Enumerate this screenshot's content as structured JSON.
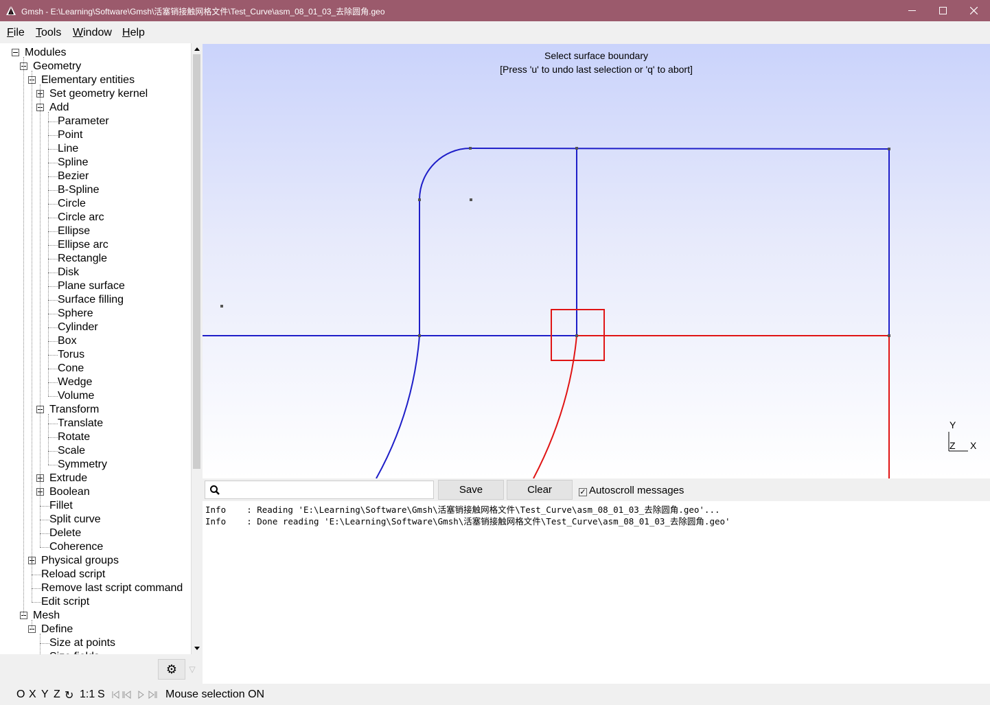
{
  "window": {
    "title": "Gmsh - E:\\Learning\\Software\\Gmsh\\活塞销接触网格文件\\Test_Curve\\asm_08_01_03_去除圆角.geo",
    "controls": [
      "minimize",
      "maximize",
      "close"
    ]
  },
  "menu": [
    {
      "key": "F",
      "rest": "ile"
    },
    {
      "key": "T",
      "rest": "ools"
    },
    {
      "key": "W",
      "rest": "indow"
    },
    {
      "key": "H",
      "rest": "elp"
    }
  ],
  "tree": {
    "items": [
      {
        "label": "Modules",
        "box": "minus"
      },
      {
        "label": "Geometry",
        "box": "minus"
      },
      {
        "label": "Elementary entities",
        "box": "minus"
      },
      {
        "label": "Set geometry kernel",
        "box": "plus"
      },
      {
        "label": "Add",
        "box": "minus"
      },
      {
        "label": "Parameter"
      },
      {
        "label": "Point"
      },
      {
        "label": "Line"
      },
      {
        "label": "Spline"
      },
      {
        "label": "Bezier"
      },
      {
        "label": "B-Spline"
      },
      {
        "label": "Circle"
      },
      {
        "label": "Circle arc"
      },
      {
        "label": "Ellipse"
      },
      {
        "label": "Ellipse arc"
      },
      {
        "label": "Rectangle"
      },
      {
        "label": "Disk"
      },
      {
        "label": "Plane surface"
      },
      {
        "label": "Surface filling"
      },
      {
        "label": "Sphere"
      },
      {
        "label": "Cylinder"
      },
      {
        "label": "Box"
      },
      {
        "label": "Torus"
      },
      {
        "label": "Cone"
      },
      {
        "label": "Wedge"
      },
      {
        "label": "Volume"
      },
      {
        "label": "Transform",
        "box": "minus"
      },
      {
        "label": "Translate"
      },
      {
        "label": "Rotate"
      },
      {
        "label": "Scale"
      },
      {
        "label": "Symmetry"
      },
      {
        "label": "Extrude",
        "box": "plus"
      },
      {
        "label": "Boolean",
        "box": "plus"
      },
      {
        "label": "Fillet"
      },
      {
        "label": "Split curve"
      },
      {
        "label": "Delete"
      },
      {
        "label": "Coherence"
      },
      {
        "label": "Physical groups",
        "box": "plus"
      },
      {
        "label": "Reload script"
      },
      {
        "label": "Remove last script command"
      },
      {
        "label": "Edit script"
      },
      {
        "label": "Mesh",
        "box": "minus"
      },
      {
        "label": "Define",
        "box": "minus"
      },
      {
        "label": "Size at points"
      },
      {
        "label": "Size fields"
      }
    ]
  },
  "graphics": {
    "prompt_line1": "Select surface boundary",
    "prompt_line2": "[Press 'u' to undo last selection or 'q' to abort]",
    "axis_y": "Y",
    "axis_z": "Z",
    "axis_x": "X",
    "colors": {
      "curve": "#1e1ec8",
      "selected": "#e01414",
      "point": "#555555"
    }
  },
  "messages": {
    "search_placeholder": "",
    "save_label": "Save",
    "clear_label": "Clear",
    "autoscroll_label": "Autoscroll messages",
    "autoscroll_checked": true,
    "lines": [
      "Info    : Reading 'E:\\Learning\\Software\\Gmsh\\活塞销接触网格文件\\Test_Curve\\asm_08_01_03_去除圆角.geo'...",
      "Info    : Done reading 'E:\\Learning\\Software\\Gmsh\\活塞销接触网格文件\\Test_Curve\\asm_08_01_03_去除圆角.geo'"
    ]
  },
  "statusbar": {
    "o": "O",
    "x": "X",
    "y": "Y",
    "z": "Z",
    "rotate": "↻",
    "scale": "1:1",
    "s": "S",
    "status": "Mouse selection ON"
  }
}
